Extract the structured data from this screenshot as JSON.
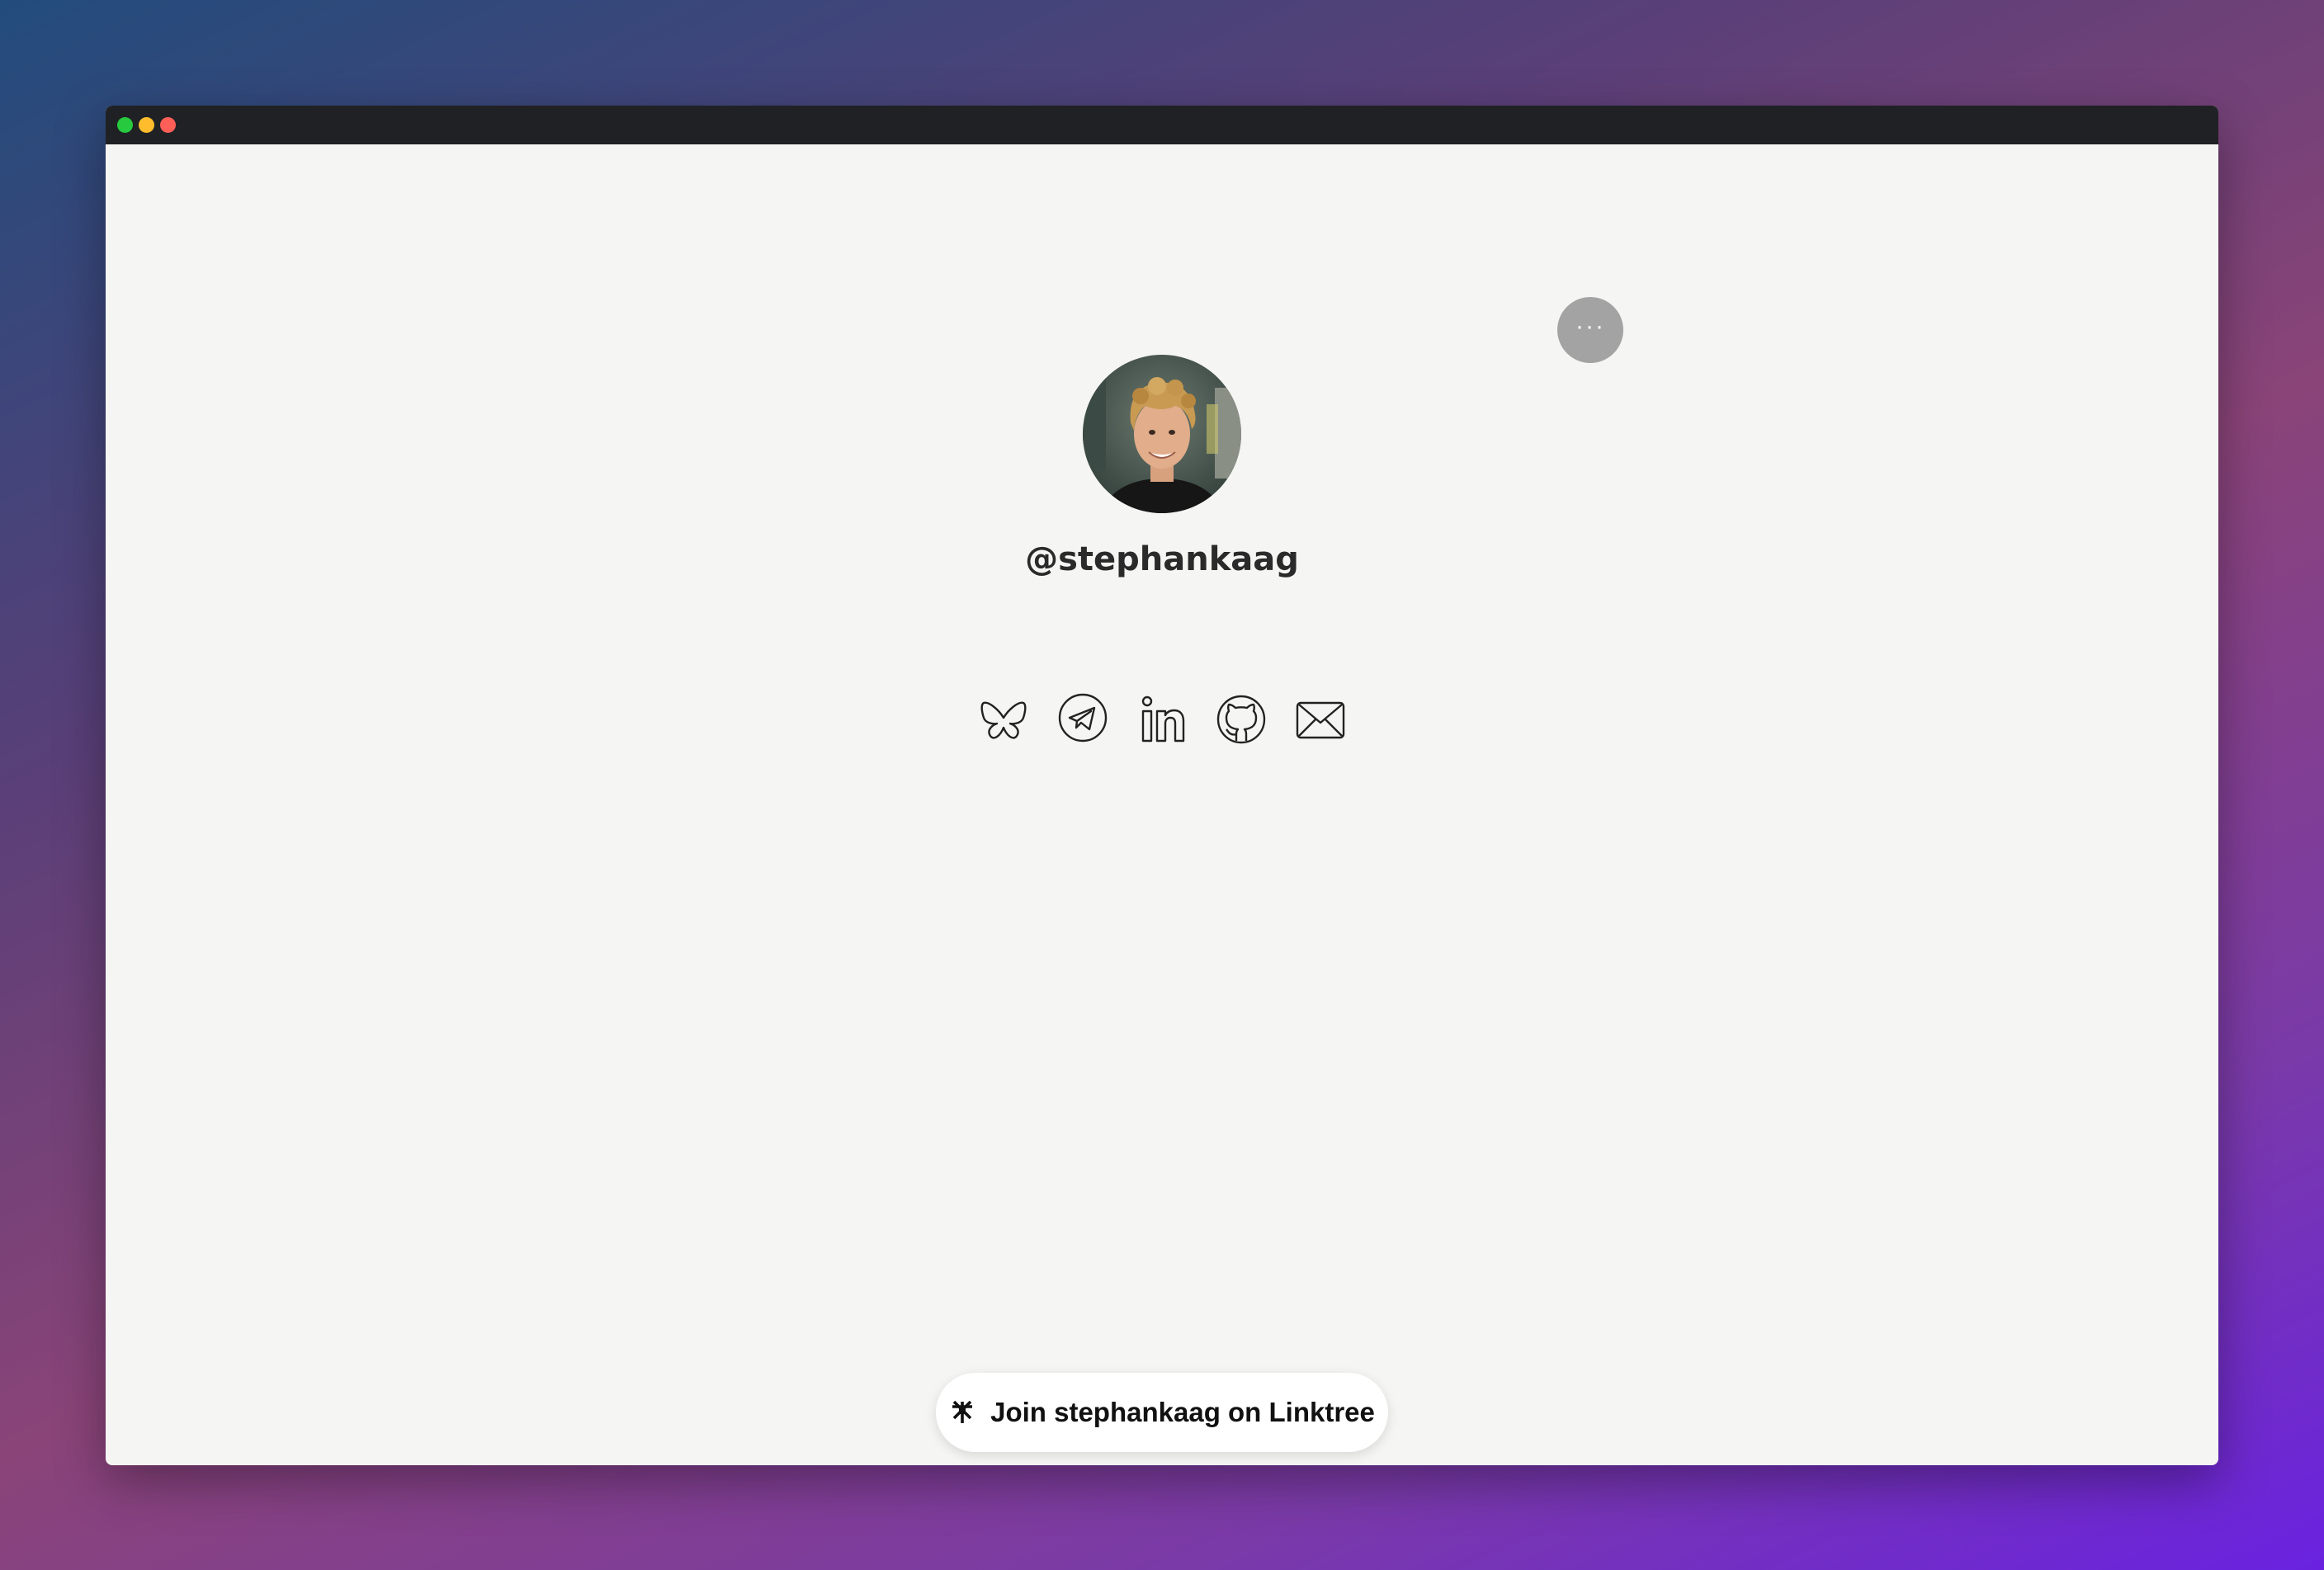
{
  "window": {
    "controls": [
      {
        "name": "green",
        "color": "#27c93f"
      },
      {
        "name": "yellow",
        "color": "#ffbd2e"
      },
      {
        "name": "red",
        "color": "#ff5f56"
      }
    ]
  },
  "profile": {
    "username": "@stephankaag",
    "avatar_icon": "profile-photo"
  },
  "more_button": {
    "label": "···",
    "icon": "ellipsis-icon"
  },
  "socials": [
    {
      "name": "bluesky",
      "icon": "butterfly-icon"
    },
    {
      "name": "telegram",
      "icon": "paper-plane-icon"
    },
    {
      "name": "linkedin",
      "icon": "linkedin-icon"
    },
    {
      "name": "github",
      "icon": "github-icon"
    },
    {
      "name": "email",
      "icon": "envelope-icon"
    }
  ],
  "join_button": {
    "label": "Join stephankaag on Linktree",
    "icon": "linktree-asterisk-icon"
  },
  "colors": {
    "background_gradient_start": "#224c7c",
    "background_gradient_end": "#6a22e0",
    "titlebar": "#202124",
    "page": "#f5f5f3",
    "more_button": "#a3a3a3"
  }
}
